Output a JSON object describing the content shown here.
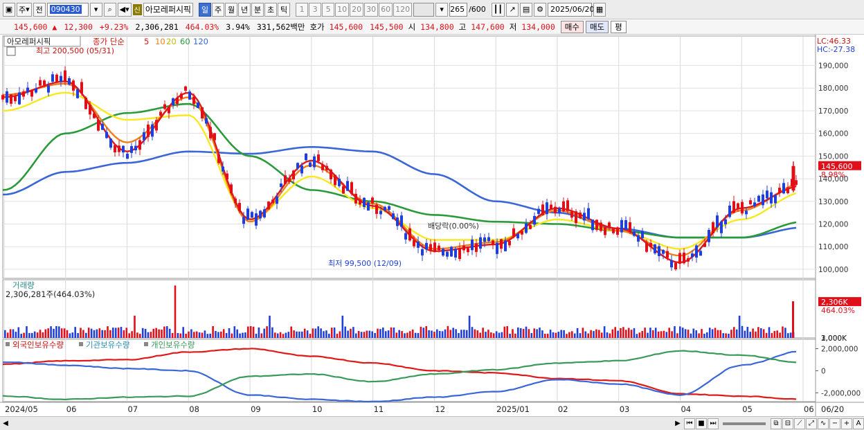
{
  "toolbar": {
    "period_label": "주",
    "mode_label": "전",
    "code": "090430",
    "badge": "신",
    "stock_name": "아모레퍼시픽",
    "periods": [
      "일",
      "주",
      "월",
      "년",
      "분",
      "초",
      "틱"
    ],
    "active_period": "일",
    "intervals": [
      "1",
      "3",
      "5",
      "10",
      "20",
      "30",
      "60",
      "120"
    ],
    "count": "265",
    "count_total": "/600",
    "date": "2025/06/20"
  },
  "quote": {
    "price": "145,600",
    "change_arrow": "▲",
    "change": "12,300",
    "change_pct": "+9.23%",
    "volume": "2,306,281",
    "volume_ratio": "464.03%",
    "turnover_rate": "3.94%",
    "amount": "331,562백만",
    "hoga_label": "호가",
    "hoga_ask": "145,600",
    "hoga_bid": "145,500",
    "open_label": "시",
    "open": "134,800",
    "high_label": "고",
    "high": "147,600",
    "low_label": "저",
    "low": "134,000",
    "buy_label": "매수",
    "sell_label": "매도",
    "eval_label": "평"
  },
  "price_panel": {
    "stock_tag": "아모레퍼시픽",
    "legend_title": "종가 단순",
    "ma_periods": [
      "5",
      "10",
      "20",
      "60",
      "120"
    ],
    "high_marker": "최고 200,500 (05/31)",
    "low_marker": "최저 99,500 (12/09)",
    "dividend_marker": "배당락(0.00%)",
    "lc_label": "LC:46.33",
    "hc_label": "HC:-27.38",
    "price_tag": "145,600",
    "pct_tag": "8.98%",
    "y_ticks": [
      "190,000",
      "180,000",
      "170,000",
      "160,000",
      "150,000",
      "140,000",
      "130,000",
      "120,000",
      "110,000",
      "100,000"
    ]
  },
  "volume_panel": {
    "title": "거래량",
    "value": "2,306,281주(464.03%)",
    "y_ticks": [
      "3,000K",
      "2,000K",
      "1,000K"
    ],
    "tag": "2,306K",
    "tag_pct": "464.03%"
  },
  "holder_panel": {
    "legend": [
      "외국인보유수량",
      "기관보유수량",
      "개인보유수량"
    ],
    "y_ticks": [
      "2,000,000",
      "0",
      "-2,000,000"
    ]
  },
  "x_axis": {
    "labels": [
      "2024/05",
      "06",
      "07",
      "08",
      "09",
      "10",
      "11",
      "12",
      "2025/01",
      "02",
      "03",
      "04",
      "05",
      "06"
    ],
    "end_label": "06/20"
  },
  "colors": {
    "up": "#e0101a",
    "down": "#1f3fd8",
    "ma5": "#e01818",
    "ma10": "#f07f1a",
    "ma20": "#f8e81e",
    "ma60": "#2a9a3a",
    "ma120": "#3a66d8",
    "foreign": "#e01818",
    "institution": "#2a8fb8",
    "individual": "#3a9a5a"
  },
  "chart_data": {
    "type": "line",
    "title": "",
    "x": [
      "2024/05",
      "06",
      "07",
      "08",
      "09",
      "10",
      "11",
      "12",
      "2025/01",
      "02",
      "03",
      "04",
      "05",
      "06"
    ],
    "series": [
      {
        "name": "5",
        "values": [
          176000,
          183000,
          152000,
          178000,
          122000,
          148000,
          128000,
          108000,
          111000,
          127000,
          118000,
          103000,
          127000,
          137000
        ]
      },
      {
        "name": "10",
        "values": [
          177000,
          182000,
          156000,
          176000,
          121000,
          146000,
          129000,
          109000,
          112000,
          126000,
          117000,
          106000,
          126000,
          138000
        ]
      },
      {
        "name": "20",
        "values": [
          170000,
          178000,
          166000,
          168000,
          122000,
          141000,
          127000,
          113000,
          113000,
          122000,
          117000,
          109000,
          122000,
          134000
        ]
      },
      {
        "name": "60",
        "values": [
          135000,
          160000,
          169000,
          173000,
          150000,
          135000,
          130000,
          124000,
          121000,
          120000,
          117000,
          114000,
          114000,
          121000
        ]
      },
      {
        "name": "120",
        "values": [
          133000,
          143000,
          147000,
          152000,
          151000,
          154000,
          152000,
          142000,
          130000,
          125000,
          118000,
          114000,
          114000,
          118500
        ]
      }
    ],
    "ylim": [
      96000,
      203000
    ]
  }
}
